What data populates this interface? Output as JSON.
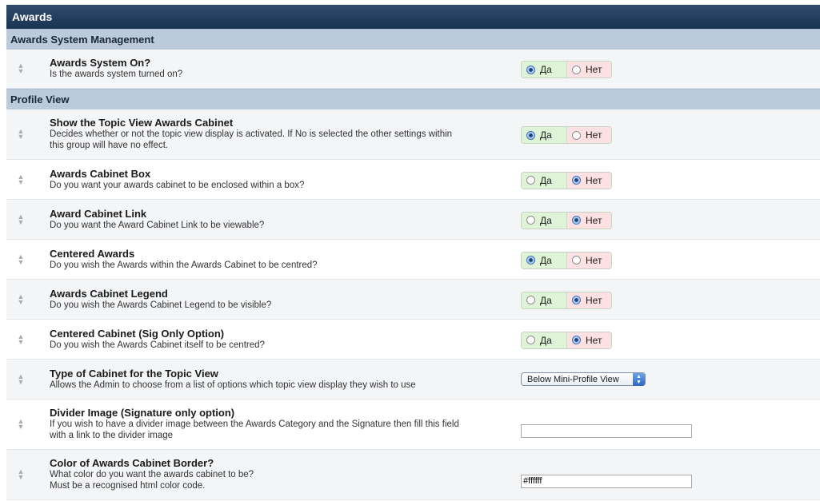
{
  "title": "Awards",
  "sections": [
    {
      "heading": "Awards System Management",
      "rows": [
        {
          "title": "Awards System On?",
          "desc": [
            "Is the awards system turned on?"
          ],
          "type": "yesno",
          "value": "yes"
        }
      ]
    },
    {
      "heading": "Profile View",
      "rows": [
        {
          "title": "Show the Topic View Awards Cabinet",
          "desc": [
            "Decides whether or not the topic view display is activated. If No is selected the other settings within",
            "this group will have no effect."
          ],
          "type": "yesno",
          "value": "yes"
        },
        {
          "title": "Awards Cabinet Box",
          "desc": [
            "Do you want your awards cabinet to be enclosed within a box?"
          ],
          "type": "yesno",
          "value": "no"
        },
        {
          "title": "Award Cabinet Link",
          "desc": [
            "Do you want the Award Cabinet Link to be viewable?"
          ],
          "type": "yesno",
          "value": "no"
        },
        {
          "title": "Centered Awards",
          "desc": [
            "Do you wish the Awards within the Awards Cabinet to be centred?"
          ],
          "type": "yesno",
          "value": "yes"
        },
        {
          "title": "Awards Cabinet Legend",
          "desc": [
            "Do you wish the Awards Cabinet Legend to be visible?"
          ],
          "type": "yesno",
          "value": "no"
        },
        {
          "title": "Centered Cabinet (Sig Only Option)",
          "desc": [
            "Do you wish the Awards Cabinet itself to be centred?"
          ],
          "type": "yesno",
          "value": "no"
        },
        {
          "title": "Type of Cabinet for the Topic View",
          "desc": [
            "Allows the Admin to choose from a list of options which topic view display they wish to use"
          ],
          "type": "select",
          "value": "Below Mini-Profile View"
        },
        {
          "title": "Divider Image (Signature only option)",
          "desc": [
            "If you wish to have a divider image between the Awards Category and the Signature then fill this field",
            "with a link to the divider image"
          ],
          "type": "text",
          "value": ""
        },
        {
          "title": "Color of Awards Cabinet Border?",
          "desc": [
            "What color do you want the awards cabinet to be?",
            "Must be a recognised html color code."
          ],
          "type": "text",
          "value": "#ffffff"
        }
      ]
    }
  ],
  "labels": {
    "yes": "Да",
    "no": "Нет"
  },
  "icons": {
    "drag": "drag-handle-icon",
    "select_arrow": "select-arrows-icon"
  },
  "colors": {
    "title_bar": "#1f3a5c",
    "section_bar": "#bccbdb",
    "yes_bg": "#dff3d7",
    "no_bg": "#fbe1e1"
  }
}
